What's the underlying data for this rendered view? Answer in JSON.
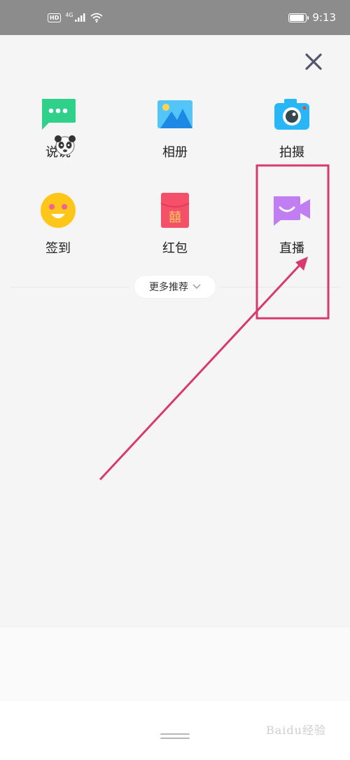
{
  "status_bar": {
    "hd": "HD",
    "network": "4G",
    "time": "9:13"
  },
  "panel": {
    "items": [
      {
        "label": "说说",
        "icon": "message-bubble-icon",
        "color": "#2fd18a"
      },
      {
        "label": "相册",
        "icon": "photo-album-icon",
        "color": "#4fc3f7"
      },
      {
        "label": "拍摄",
        "icon": "camera-icon",
        "color": "#29b6f6"
      },
      {
        "label": "签到",
        "icon": "smiley-face-icon",
        "color": "#ffc61a"
      },
      {
        "label": "红包",
        "icon": "red-packet-icon",
        "color": "#f4506a"
      },
      {
        "label": "直播",
        "icon": "video-camera-icon",
        "color": "#c07ef2"
      }
    ],
    "more_label": "更多推荐"
  },
  "watermark": "Baidu经验",
  "colors": {
    "annotation": "#d63a6e",
    "panel_bg": "#f5f5f6",
    "close": "#555570"
  }
}
